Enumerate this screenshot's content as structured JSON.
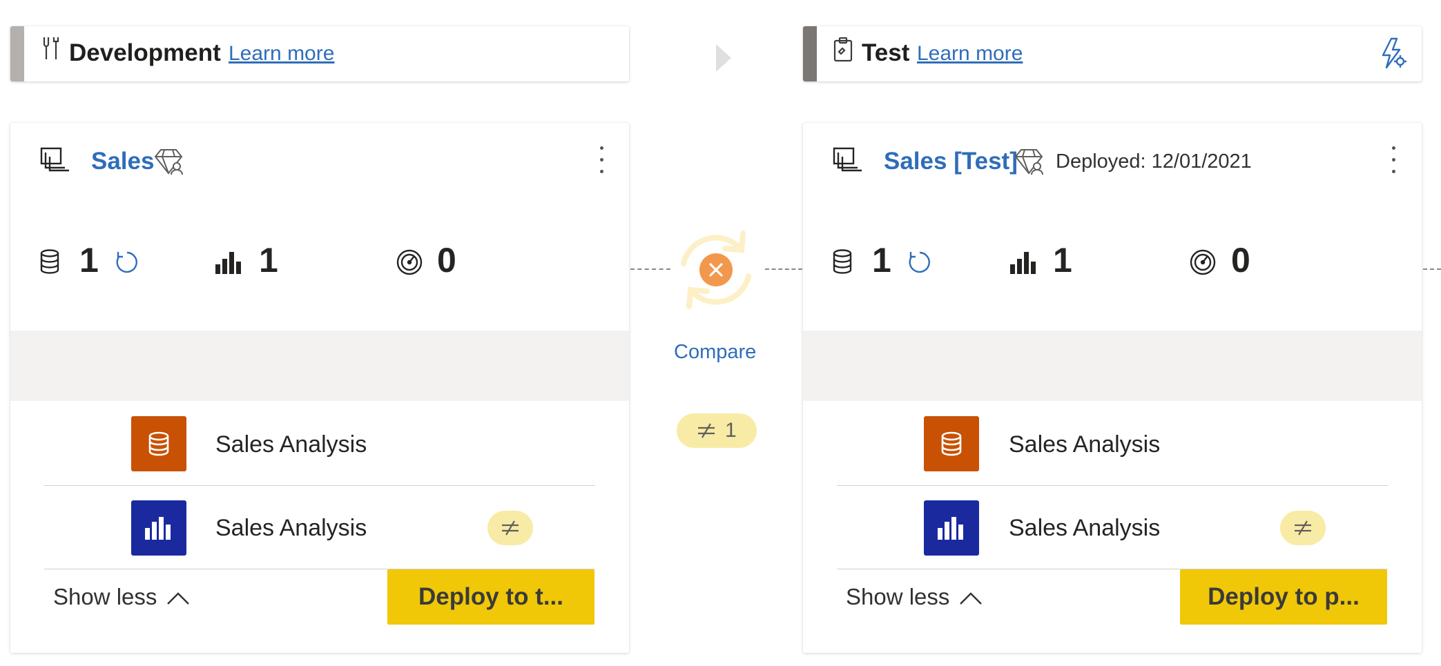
{
  "stages": [
    {
      "name": "Development",
      "learn_more": "Learn more",
      "bar_color": "#b3b0ad",
      "icon": "tools-icon",
      "workspace": {
        "name": "Sales",
        "deployed": "",
        "counts": {
          "datasets": "1",
          "reports": "1",
          "dashboards": "0"
        },
        "items": [
          {
            "type": "dataset",
            "name": "Sales Analysis",
            "different": false
          },
          {
            "type": "report",
            "name": "Sales Analysis",
            "different": true
          }
        ],
        "show_less": "Show less",
        "deploy_label": "Deploy to t..."
      }
    },
    {
      "name": "Test",
      "learn_more": "Learn more",
      "bar_color": "#7a7774",
      "icon": "clipboard-icon",
      "workspace": {
        "name": "Sales [Test]",
        "deployed": "Deployed: 12/01/2021",
        "counts": {
          "datasets": "1",
          "reports": "1",
          "dashboards": "0"
        },
        "items": [
          {
            "type": "dataset",
            "name": "Sales Analysis",
            "different": false
          },
          {
            "type": "report",
            "name": "Sales Analysis",
            "different": true
          }
        ],
        "show_less": "Show less",
        "deploy_label": "Deploy to p..."
      }
    }
  ],
  "compare": {
    "label": "Compare",
    "diff_count": "1",
    "status": "different"
  },
  "colors": {
    "accent": "#2f6dba",
    "dataset_tile": "#c85103",
    "report_tile": "#1a2a9e",
    "deploy_button": "#f0c808",
    "diff_badge": "#f8eba6",
    "compare_error": "#f2984c"
  }
}
